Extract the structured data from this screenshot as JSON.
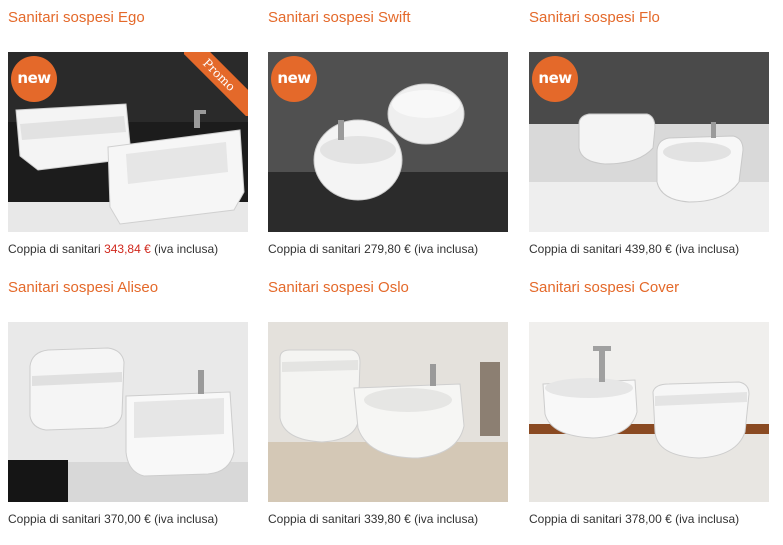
{
  "products": [
    {
      "title": "Sanitari sospesi Ego",
      "badge": "new",
      "promo": "Promo",
      "caption_prefix": "Coppia di sanitari ",
      "price": "343,84 €",
      "price_highlight": true,
      "caption_suffix": " (iva inclusa)"
    },
    {
      "title": "Sanitari sospesi Swift",
      "badge": "new",
      "caption_prefix": "Coppia di sanitari ",
      "price": "279,80 €",
      "price_highlight": false,
      "caption_suffix": " (iva inclusa)"
    },
    {
      "title": "Sanitari sospesi Flo",
      "badge": "new",
      "caption_prefix": "Coppia di sanitari ",
      "price": "439,80 €",
      "price_highlight": false,
      "caption_suffix": " (iva inclusa)"
    },
    {
      "title": "Sanitari sospesi Aliseo",
      "caption_prefix": "Coppia di sanitari ",
      "price": "370,00 €",
      "price_highlight": false,
      "caption_suffix": " (iva inclusa)"
    },
    {
      "title": "Sanitari sospesi Oslo",
      "caption_prefix": "Coppia di sanitari ",
      "price": "339,80 €",
      "price_highlight": false,
      "caption_suffix": " (iva inclusa)"
    },
    {
      "title": "Sanitari sospesi Cover",
      "caption_prefix": "Coppia di sanitari ",
      "price": "378,00 €",
      "price_highlight": false,
      "caption_suffix": " (iva inclusa)"
    }
  ],
  "colors": {
    "accent": "#e4692a",
    "price_highlight": "#d0281d",
    "text": "#333333"
  }
}
